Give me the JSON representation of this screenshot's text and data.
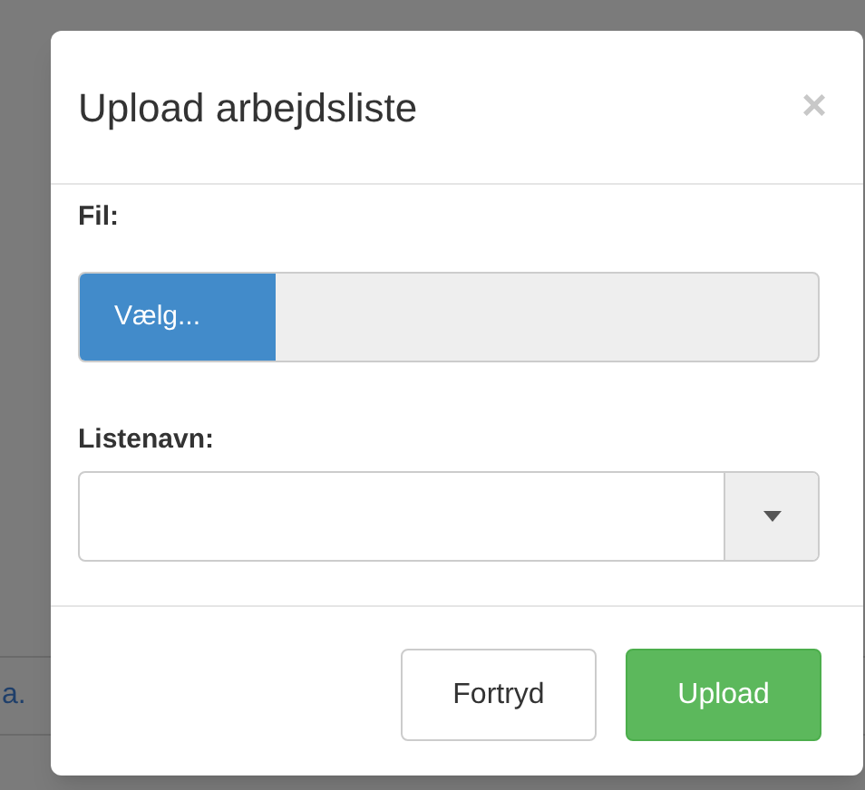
{
  "background": {
    "rows": [
      {
        "cells": [
          "a."
        ]
      }
    ]
  },
  "dialog": {
    "title": "Upload arbejdsliste",
    "close": "×",
    "file_label": "Fil:",
    "file_button": "Vælg...",
    "list_label": "Listenavn:",
    "buttons": [
      {
        "label": "Fortryd",
        "kind": "default"
      },
      {
        "label": "Upload",
        "kind": "primary"
      }
    ]
  }
}
